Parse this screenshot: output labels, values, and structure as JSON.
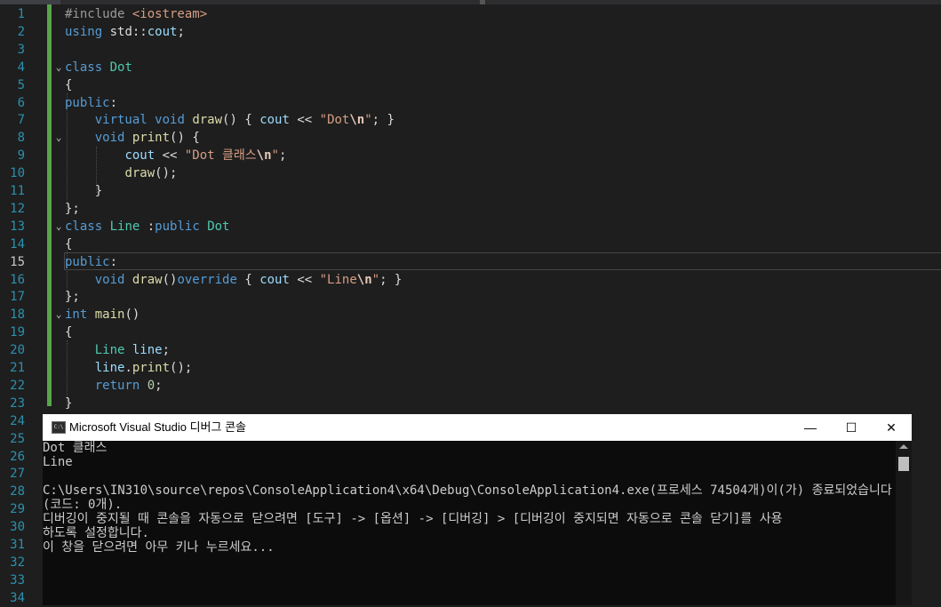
{
  "editor": {
    "lines": [
      {
        "num": "1",
        "tokens": [
          {
            "c": "pp",
            "t": "#include "
          },
          {
            "c": "s",
            "t": "<iostream>"
          }
        ]
      },
      {
        "num": "2",
        "tokens": [
          {
            "c": "k",
            "t": "using"
          },
          {
            "c": "",
            "t": " std::"
          },
          {
            "c": "v",
            "t": "cout"
          },
          {
            "c": "",
            "t": ";"
          }
        ]
      },
      {
        "num": "3",
        "tokens": []
      },
      {
        "num": "4",
        "fold": "v",
        "tokens": [
          {
            "c": "k",
            "t": "class"
          },
          {
            "c": "",
            "t": " "
          },
          {
            "c": "ty",
            "t": "Dot"
          }
        ]
      },
      {
        "num": "5",
        "tokens": [
          {
            "c": "",
            "t": "{"
          }
        ]
      },
      {
        "num": "6",
        "tokens": [
          {
            "c": "k",
            "t": "public"
          },
          {
            "c": "",
            "t": ":"
          }
        ]
      },
      {
        "num": "7",
        "tokens": [
          {
            "c": "",
            "t": "    "
          },
          {
            "c": "k",
            "t": "virtual"
          },
          {
            "c": "",
            "t": " "
          },
          {
            "c": "k",
            "t": "void"
          },
          {
            "c": "",
            "t": " "
          },
          {
            "c": "fn",
            "t": "draw"
          },
          {
            "c": "",
            "t": "() { "
          },
          {
            "c": "v",
            "t": "cout"
          },
          {
            "c": "",
            "t": " << "
          },
          {
            "c": "s",
            "t": "\"Dot"
          },
          {
            "c": "esc",
            "t": "\\n"
          },
          {
            "c": "s",
            "t": "\""
          },
          {
            "c": "",
            "t": "; }"
          }
        ]
      },
      {
        "num": "8",
        "fold": "v",
        "tokens": [
          {
            "c": "",
            "t": "    "
          },
          {
            "c": "k",
            "t": "void"
          },
          {
            "c": "",
            "t": " "
          },
          {
            "c": "fn",
            "t": "print"
          },
          {
            "c": "",
            "t": "() {"
          }
        ]
      },
      {
        "num": "9",
        "tokens": [
          {
            "c": "",
            "t": "        "
          },
          {
            "c": "v",
            "t": "cout"
          },
          {
            "c": "",
            "t": " << "
          },
          {
            "c": "s",
            "t": "\"Dot 클래스"
          },
          {
            "c": "esc",
            "t": "\\n"
          },
          {
            "c": "s",
            "t": "\""
          },
          {
            "c": "",
            "t": ";"
          }
        ]
      },
      {
        "num": "10",
        "tokens": [
          {
            "c": "",
            "t": "        "
          },
          {
            "c": "fn",
            "t": "draw"
          },
          {
            "c": "",
            "t": "();"
          }
        ]
      },
      {
        "num": "11",
        "tokens": [
          {
            "c": "",
            "t": "    }"
          }
        ]
      },
      {
        "num": "12",
        "tokens": [
          {
            "c": "",
            "t": "};"
          }
        ]
      },
      {
        "num": "13",
        "fold": "v",
        "tokens": [
          {
            "c": "k",
            "t": "class"
          },
          {
            "c": "",
            "t": " "
          },
          {
            "c": "ty",
            "t": "Line"
          },
          {
            "c": "",
            "t": " :"
          },
          {
            "c": "k",
            "t": "public"
          },
          {
            "c": "",
            "t": " "
          },
          {
            "c": "ty",
            "t": "Dot"
          }
        ]
      },
      {
        "num": "14",
        "tokens": [
          {
            "c": "",
            "t": "{"
          }
        ]
      },
      {
        "num": "15",
        "active": true,
        "tokens": [
          {
            "c": "k",
            "t": "public"
          },
          {
            "c": "",
            "t": ":"
          }
        ]
      },
      {
        "num": "16",
        "tokens": [
          {
            "c": "",
            "t": "    "
          },
          {
            "c": "k",
            "t": "void"
          },
          {
            "c": "",
            "t": " "
          },
          {
            "c": "fn",
            "t": "draw"
          },
          {
            "c": "",
            "t": "()"
          },
          {
            "c": "k",
            "t": "override"
          },
          {
            "c": "",
            "t": " { "
          },
          {
            "c": "v",
            "t": "cout"
          },
          {
            "c": "",
            "t": " << "
          },
          {
            "c": "s",
            "t": "\"Line"
          },
          {
            "c": "esc",
            "t": "\\n"
          },
          {
            "c": "s",
            "t": "\""
          },
          {
            "c": "",
            "t": "; }"
          }
        ]
      },
      {
        "num": "17",
        "tokens": [
          {
            "c": "",
            "t": "};"
          }
        ]
      },
      {
        "num": "18",
        "fold": "v",
        "tokens": [
          {
            "c": "k",
            "t": "int"
          },
          {
            "c": "",
            "t": " "
          },
          {
            "c": "fn",
            "t": "main"
          },
          {
            "c": "",
            "t": "()"
          }
        ]
      },
      {
        "num": "19",
        "tokens": [
          {
            "c": "",
            "t": "{"
          }
        ]
      },
      {
        "num": "20",
        "tokens": [
          {
            "c": "",
            "t": "    "
          },
          {
            "c": "ty",
            "t": "Line"
          },
          {
            "c": "",
            "t": " "
          },
          {
            "c": "v",
            "t": "line"
          },
          {
            "c": "",
            "t": ";"
          }
        ]
      },
      {
        "num": "21",
        "tokens": [
          {
            "c": "",
            "t": "    "
          },
          {
            "c": "v",
            "t": "line"
          },
          {
            "c": "",
            "t": "."
          },
          {
            "c": "fn",
            "t": "print"
          },
          {
            "c": "",
            "t": "();"
          }
        ]
      },
      {
        "num": "22",
        "tokens": [
          {
            "c": "",
            "t": "    "
          },
          {
            "c": "k",
            "t": "return"
          },
          {
            "c": "",
            "t": " "
          },
          {
            "c": "n",
            "t": "0"
          },
          {
            "c": "",
            "t": ";"
          }
        ]
      },
      {
        "num": "23",
        "tokens": [
          {
            "c": "",
            "t": "}"
          }
        ]
      },
      {
        "num": "24",
        "tokens": []
      },
      {
        "num": "25",
        "tokens": []
      },
      {
        "num": "26",
        "tokens": []
      },
      {
        "num": "27",
        "tokens": []
      },
      {
        "num": "28",
        "tokens": []
      },
      {
        "num": "29",
        "tokens": []
      },
      {
        "num": "30",
        "tokens": []
      },
      {
        "num": "31",
        "tokens": []
      },
      {
        "num": "32",
        "tokens": []
      },
      {
        "num": "33",
        "tokens": []
      },
      {
        "num": "34",
        "tokens": []
      }
    ]
  },
  "console": {
    "icon_label": "C:\\",
    "title": "Microsoft Visual Studio 디버그 콘솔",
    "minimize": "—",
    "maximize": "☐",
    "close": "✕",
    "output": [
      "Dot 클래스",
      "Line",
      "",
      "C:\\Users\\IN310\\source\\repos\\ConsoleApplication4\\x64\\Debug\\ConsoleApplication4.exe(프로세스 74504개)이(가) 종료되었습니다",
      "(코드: 0개).",
      "디버깅이 중지될 때 콘솔을 자동으로 닫으려면 [도구] -> [옵션] -> [디버깅] > [디버깅이 중지되면 자동으로 콘솔 닫기]를 사용",
      "하도록 설정합니다.",
      "이 창을 닫으려면 아무 키나 누르세요..."
    ]
  },
  "colors": {
    "editor_bg": "#1e1e1e",
    "keyword": "#569cd6",
    "type": "#4ec9b0",
    "function": "#dcdcaa",
    "string": "#d69d85",
    "variable": "#9cdcfe",
    "change_bar": "#57a64a",
    "console_bg": "#0c0c0c"
  }
}
